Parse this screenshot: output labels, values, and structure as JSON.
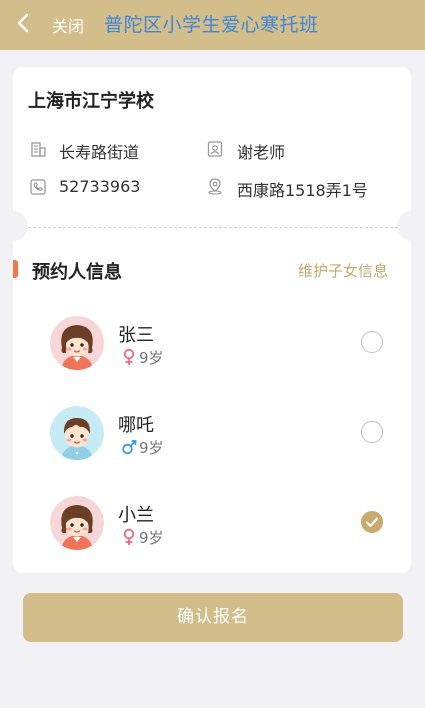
{
  "header": {
    "close_label": "关闭",
    "title": "普陀区小学生爱心寒托班",
    "background": "#d3bd8b",
    "title_color": "#3e86d8"
  },
  "school": {
    "name": "上海市江宁学校",
    "street": "长寿路街道",
    "teacher": "谢老师",
    "phone": "52733963",
    "address": "西康路1518弄1号"
  },
  "section": {
    "title": "预约人信息",
    "maintain_link": "维护子女信息",
    "accent": "#f0784b"
  },
  "people": [
    {
      "name": "张三",
      "gender": "female",
      "gender_icon": "female-icon",
      "age": "9岁",
      "selected": false
    },
    {
      "name": "哪吒",
      "gender": "male",
      "gender_icon": "male-icon",
      "age": "9岁",
      "selected": false
    },
    {
      "name": "小兰",
      "gender": "female",
      "gender_icon": "female-icon",
      "age": "9岁",
      "selected": true
    }
  ],
  "confirm_label": "确认报名"
}
